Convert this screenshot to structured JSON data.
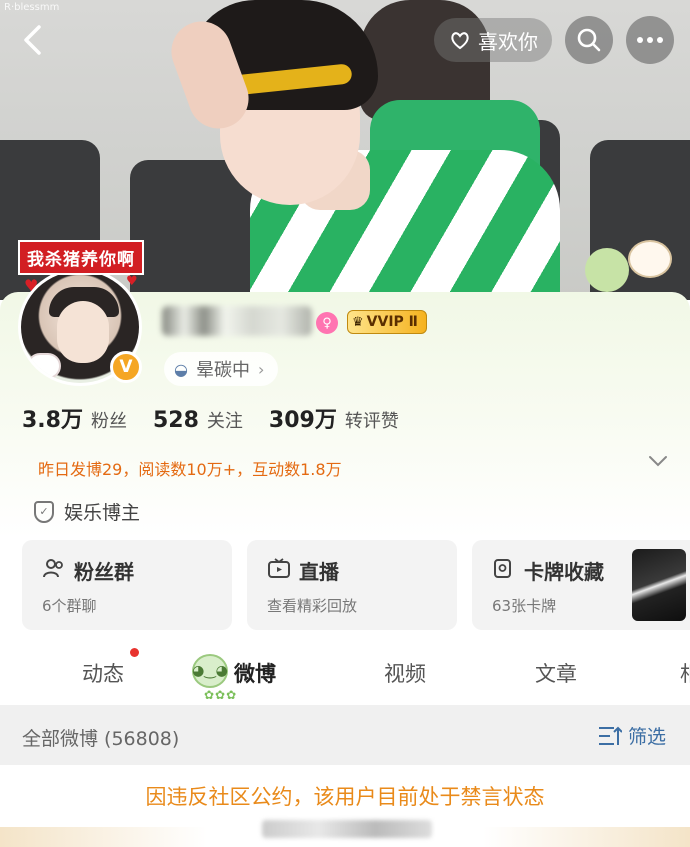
{
  "header": {
    "like_label": "喜欢你",
    "watermark": "R·blessmm"
  },
  "profile": {
    "tag_banner": "我杀猪养你啊",
    "verify_badge": "V",
    "vip_label": "VVIP Ⅱ",
    "status": "晕碳中",
    "stats": [
      {
        "num": "3.8万",
        "label": "粉丝"
      },
      {
        "num": "528",
        "label": "关注"
      },
      {
        "num": "309万",
        "label": "转评赞"
      }
    ],
    "activity": "昨日发博29，阅读数10万+，互动数1.8万",
    "category": "娱乐博主"
  },
  "cards": [
    {
      "title": "粉丝群",
      "sub": "6个群聊",
      "icon": "group-icon"
    },
    {
      "title": "直播",
      "sub": "查看精彩回放",
      "icon": "tv-icon"
    },
    {
      "title": "卡牌收藏",
      "sub": "63张卡牌",
      "icon": "card-collection-icon"
    }
  ],
  "tabs": [
    "动态",
    "微博",
    "视频",
    "文章",
    "相"
  ],
  "feed": {
    "count_label": "全部微博 (56808)",
    "filter_label": "筛选"
  },
  "notice": "因违反社区公约，该用户目前处于禁言状态",
  "colors": {
    "accent_orange": "#e46a12",
    "notice_orange": "#e98a1a",
    "link_blue": "#3c6ea4",
    "banner_red": "#d21e23"
  }
}
